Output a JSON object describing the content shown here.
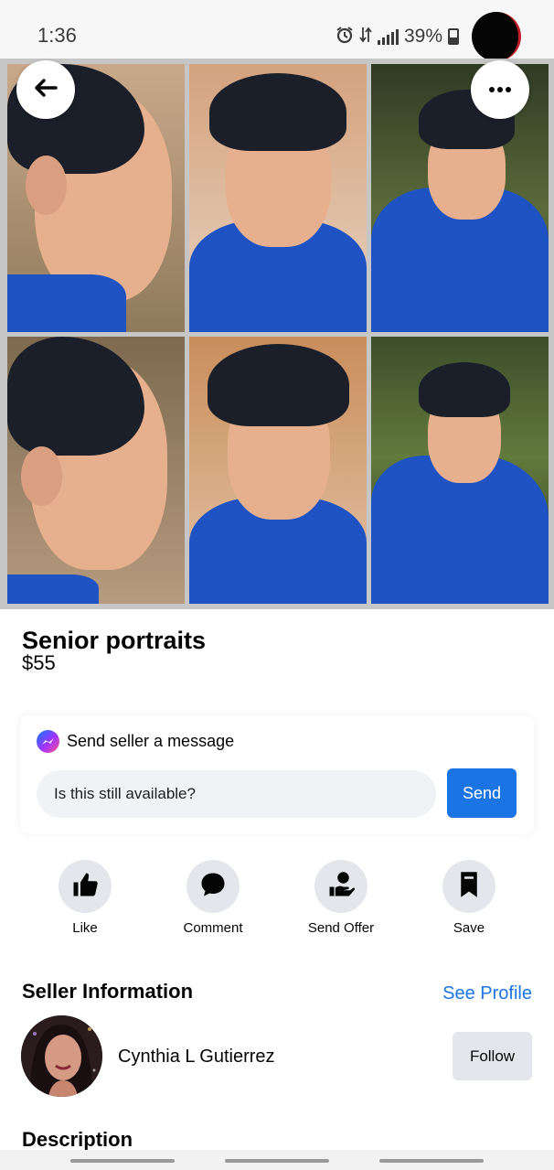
{
  "status_bar": {
    "time": "1:36",
    "battery_percent": "39%",
    "icons": [
      "alarm-icon",
      "data-arrows-icon",
      "signal-icon",
      "battery-icon"
    ]
  },
  "photo_grid": {
    "photo_count": 6
  },
  "listing": {
    "title": "Senior portraits",
    "price": "$55"
  },
  "message_card": {
    "title": "Send seller a message",
    "input_value": "Is this still available?",
    "send_label": "Send"
  },
  "actions": [
    {
      "label": "Like",
      "icon": "thumbs-up-icon"
    },
    {
      "label": "Comment",
      "icon": "comment-bubble-icon"
    },
    {
      "label": "Send Offer",
      "icon": "send-offer-icon"
    },
    {
      "label": "Save",
      "icon": "bookmark-icon"
    }
  ],
  "seller": {
    "heading": "Seller Information",
    "see_profile_label": "See Profile",
    "name": "Cynthia L Gutierrez",
    "follow_label": "Follow"
  },
  "description": {
    "heading": "Description"
  },
  "colors": {
    "accent": "#1b74e4",
    "shirt": "#1f52c2",
    "button_bg": "#e4e6eb"
  }
}
